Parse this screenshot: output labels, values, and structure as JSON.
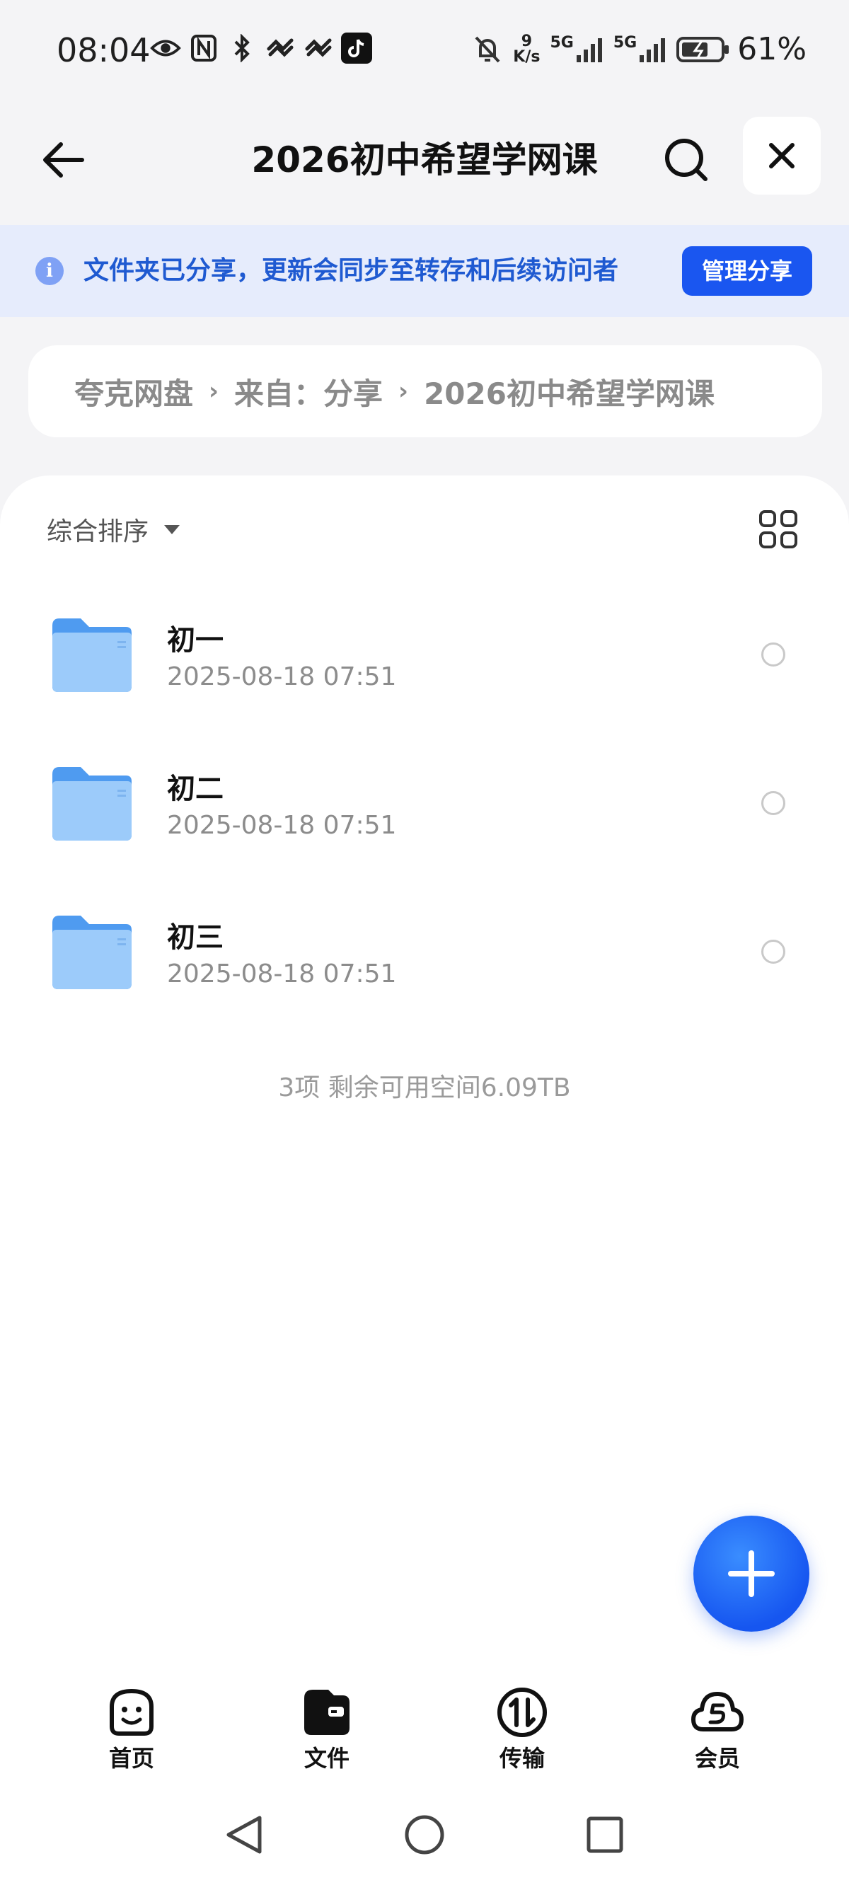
{
  "status_bar": {
    "time": "08:04",
    "net_speed_value": "9",
    "net_speed_unit": "K/s",
    "sim1_label": "5G",
    "sim2_label": "5G",
    "battery": "61%"
  },
  "header": {
    "title": "2026初中希望学网课"
  },
  "banner": {
    "text": "文件夹已分享，更新会同步至转存和后续访问者",
    "button_label": "管理分享"
  },
  "breadcrumb": {
    "items": [
      "夸克网盘",
      "来自：分享",
      "2026初中希望学网课"
    ]
  },
  "sort": {
    "label": "综合排序"
  },
  "files": [
    {
      "name": "初一",
      "date": "2025-08-18 07:51"
    },
    {
      "name": "初二",
      "date": "2025-08-18 07:51"
    },
    {
      "name": "初三",
      "date": "2025-08-18 07:51"
    }
  ],
  "summary": "3项 剩余可用空间6.09TB",
  "bottom_nav": {
    "items": [
      {
        "label": "首页",
        "icon": "home-smile-icon"
      },
      {
        "label": "文件",
        "icon": "file-wallet-icon"
      },
      {
        "label": "传输",
        "icon": "transfer-icon"
      },
      {
        "label": "会员",
        "icon": "member-cloud-icon"
      }
    ]
  },
  "colors": {
    "accent": "#1a56f0",
    "banner_bg": "#e6ecfc",
    "banner_text": "#1f5ad1",
    "folder": "#5aa6f5"
  }
}
